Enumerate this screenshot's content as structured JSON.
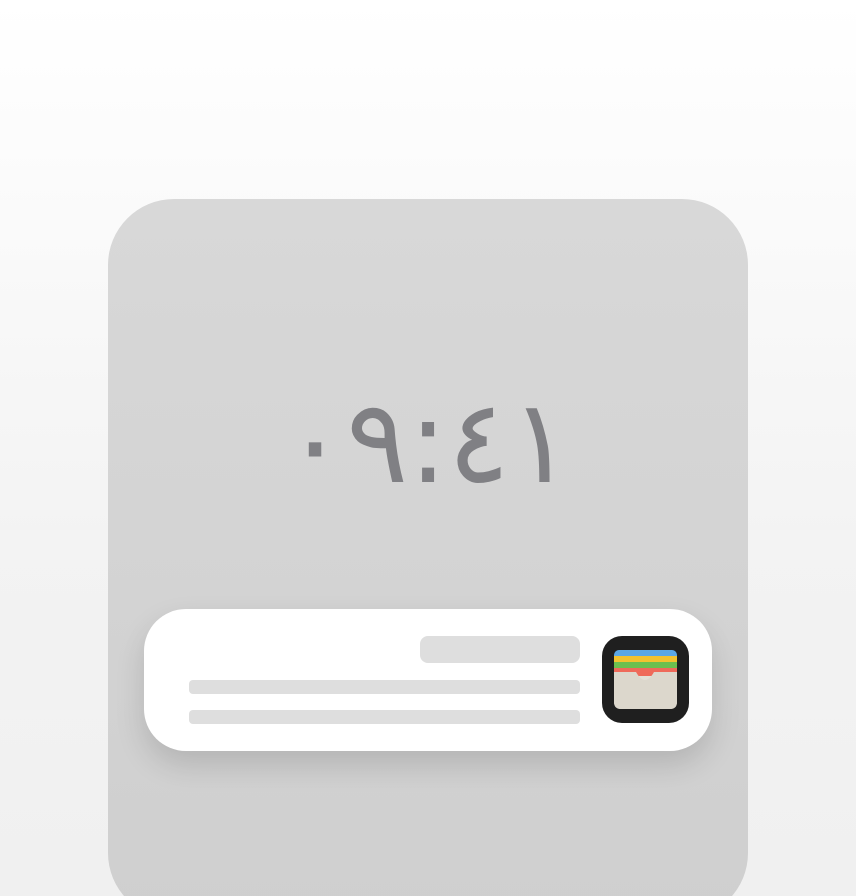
{
  "lock_screen": {
    "time": "٠٩:٤١"
  },
  "notification": {
    "app_icon": "wallet-icon",
    "title_placeholder": "",
    "body_placeholder": ""
  },
  "colors": {
    "background": "#f3f3f3",
    "phone_screen": "#d4d4d4",
    "clock_text": "#808084",
    "notification_bg": "#ffffff",
    "skeleton": "#dedede",
    "icon_bg": "#1f1f1f"
  }
}
